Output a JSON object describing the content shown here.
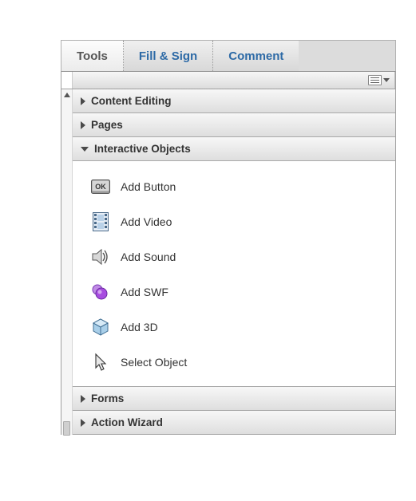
{
  "tabs": {
    "tools": "Tools",
    "fill_sign": "Fill & Sign",
    "comment": "Comment",
    "active": "tools"
  },
  "accordion": {
    "content_editing": {
      "label": "Content Editing",
      "open": false
    },
    "pages": {
      "label": "Pages",
      "open": false
    },
    "interactive": {
      "label": "Interactive Objects",
      "open": true
    },
    "forms": {
      "label": "Forms",
      "open": false
    },
    "action_wizard": {
      "label": "Action Wizard",
      "open": false
    }
  },
  "interactive_tools": {
    "add_button": "Add Button",
    "add_video": "Add Video",
    "add_sound": "Add Sound",
    "add_swf": "Add SWF",
    "add_3d": "Add 3D",
    "select_object": "Select Object"
  },
  "icons": {
    "ok_label": "OK"
  }
}
